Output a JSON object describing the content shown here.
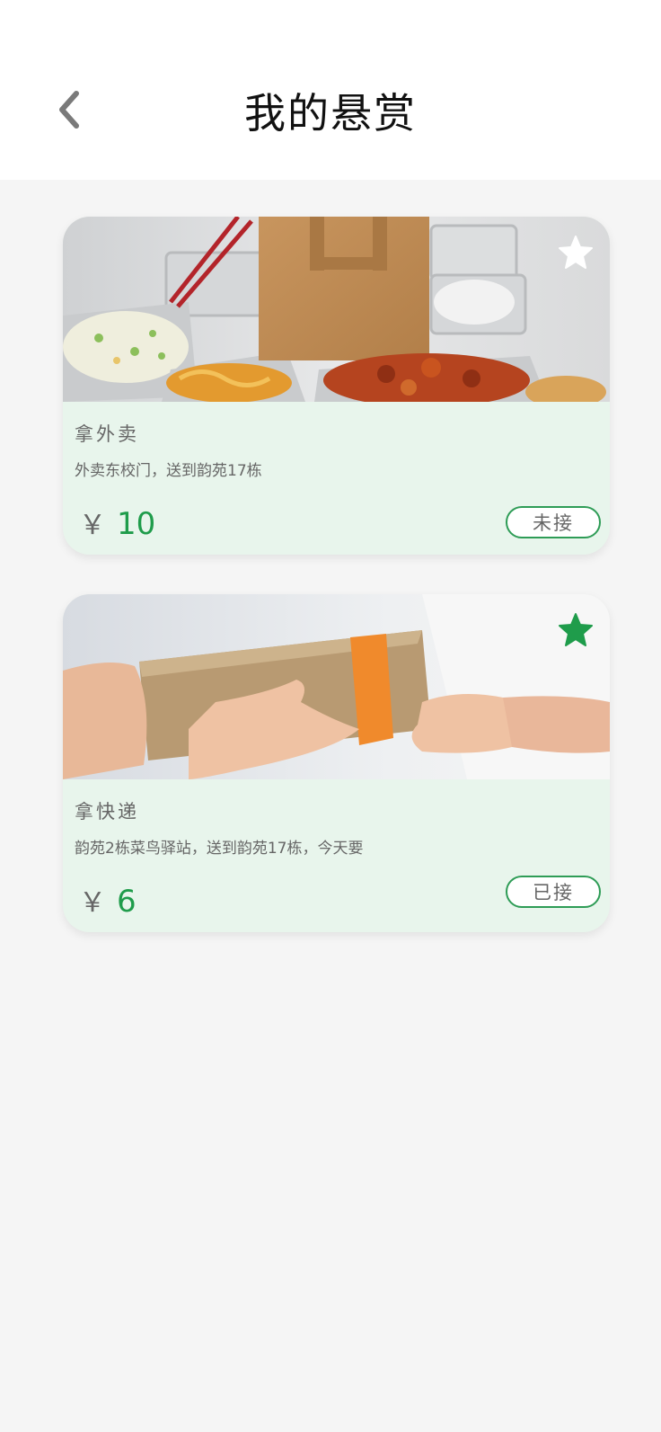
{
  "header": {
    "title": "我的悬赏",
    "back_icon": "chevron-left-icon"
  },
  "tasks": [
    {
      "title": "拿外卖",
      "description": "外卖东校门，送到韵苑17栋",
      "currency": "￥",
      "amount": "10",
      "status": "未接",
      "favorited": false,
      "image": "takeout-food-photo"
    },
    {
      "title": "拿快递",
      "description": "韵苑2栋菜鸟驿站，送到韵苑17栋，今天要",
      "currency": "￥",
      "amount": "6",
      "status": "已接",
      "favorited": true,
      "image": "package-handoff-photo"
    }
  ],
  "colors": {
    "accent_green": "#1f9c4b",
    "card_bg": "#e8f5ec",
    "page_bg": "#f5f5f5"
  }
}
